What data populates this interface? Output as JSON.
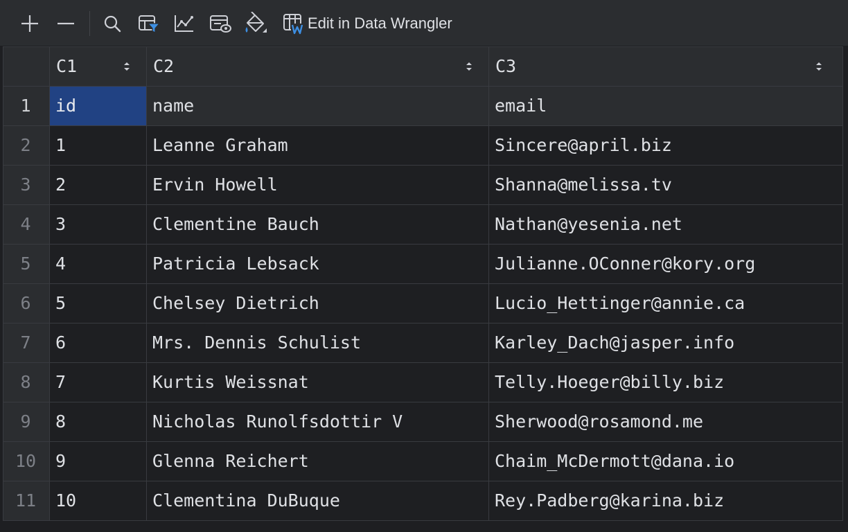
{
  "toolbar": {
    "buttons": [
      {
        "name": "add-row-button",
        "icon": "plus-icon"
      },
      {
        "name": "remove-row-button",
        "icon": "minus-icon"
      },
      {
        "name": "search-button",
        "icon": "search-icon"
      },
      {
        "name": "filter-button",
        "icon": "filter-icon"
      },
      {
        "name": "chart-button",
        "icon": "line-chart-icon"
      },
      {
        "name": "view-button",
        "icon": "table-view-icon"
      },
      {
        "name": "paint-button",
        "icon": "paint-bucket-icon"
      }
    ],
    "wrangler_label": "Edit in Data Wrangler",
    "wrangler_icon": "data-wrangler-icon"
  },
  "grid": {
    "columns": [
      "C1",
      "C2",
      "C3"
    ],
    "rows": [
      {
        "num": "1",
        "c1": "id",
        "c2": "name",
        "c3": "email"
      },
      {
        "num": "2",
        "c1": "1",
        "c2": "Leanne Graham",
        "c3": "Sincere@april.biz"
      },
      {
        "num": "3",
        "c1": "2",
        "c2": "Ervin Howell",
        "c3": "Shanna@melissa.tv"
      },
      {
        "num": "4",
        "c1": "3",
        "c2": "Clementine Bauch",
        "c3": "Nathan@yesenia.net"
      },
      {
        "num": "5",
        "c1": "4",
        "c2": "Patricia Lebsack",
        "c3": "Julianne.OConner@kory.org"
      },
      {
        "num": "6",
        "c1": "5",
        "c2": "Chelsey Dietrich",
        "c3": "Lucio_Hettinger@annie.ca"
      },
      {
        "num": "7",
        "c1": "6",
        "c2": "Mrs. Dennis Schulist",
        "c3": "Karley_Dach@jasper.info"
      },
      {
        "num": "8",
        "c1": "7",
        "c2": "Kurtis Weissnat",
        "c3": "Telly.Hoeger@billy.biz"
      },
      {
        "num": "9",
        "c1": "8",
        "c2": "Nicholas Runolfsdottir V",
        "c3": "Sherwood@rosamond.me"
      },
      {
        "num": "10",
        "c1": "9",
        "c2": "Glenna Reichert",
        "c3": "Chaim_McDermott@dana.io"
      },
      {
        "num": "11",
        "c1": "10",
        "c2": "Clementina DuBuque",
        "c3": "Rey.Padberg@karina.biz"
      }
    ]
  },
  "colors": {
    "background": "#1e1f22",
    "header": "#2b2d30",
    "selection": "#214283",
    "accent_blue": "#3d8fe3"
  }
}
